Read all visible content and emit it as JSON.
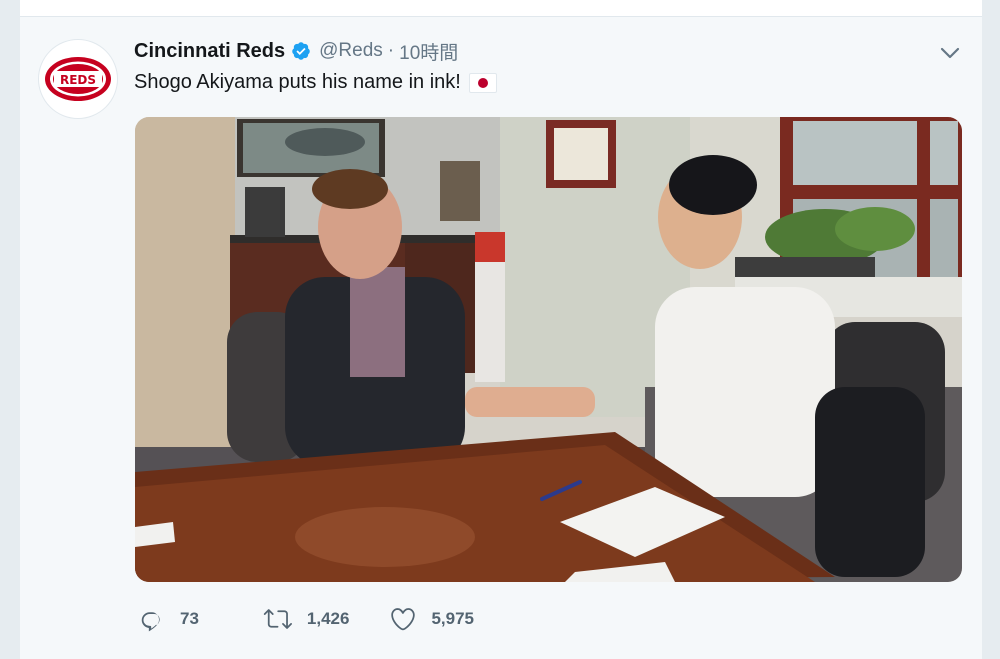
{
  "tweet": {
    "author_name": "Cincinnati Reds",
    "handle": "@Reds",
    "separator": "·",
    "time": "10時間",
    "text": "Shogo Akiyama puts his name in ink!",
    "logo_text": "REDS",
    "replies": "73",
    "retweets": "1,426",
    "likes": "5,975"
  },
  "icons": {
    "verified": "verified-badge-icon",
    "more": "chevron-down-icon",
    "reply": "reply-icon",
    "retweet": "retweet-icon",
    "like": "heart-icon",
    "flag": "japan-flag-emoji"
  },
  "colors": {
    "accent": "#1da1f2",
    "reds_red": "#c6011f",
    "text_primary": "#14171a",
    "text_secondary": "#657786"
  }
}
